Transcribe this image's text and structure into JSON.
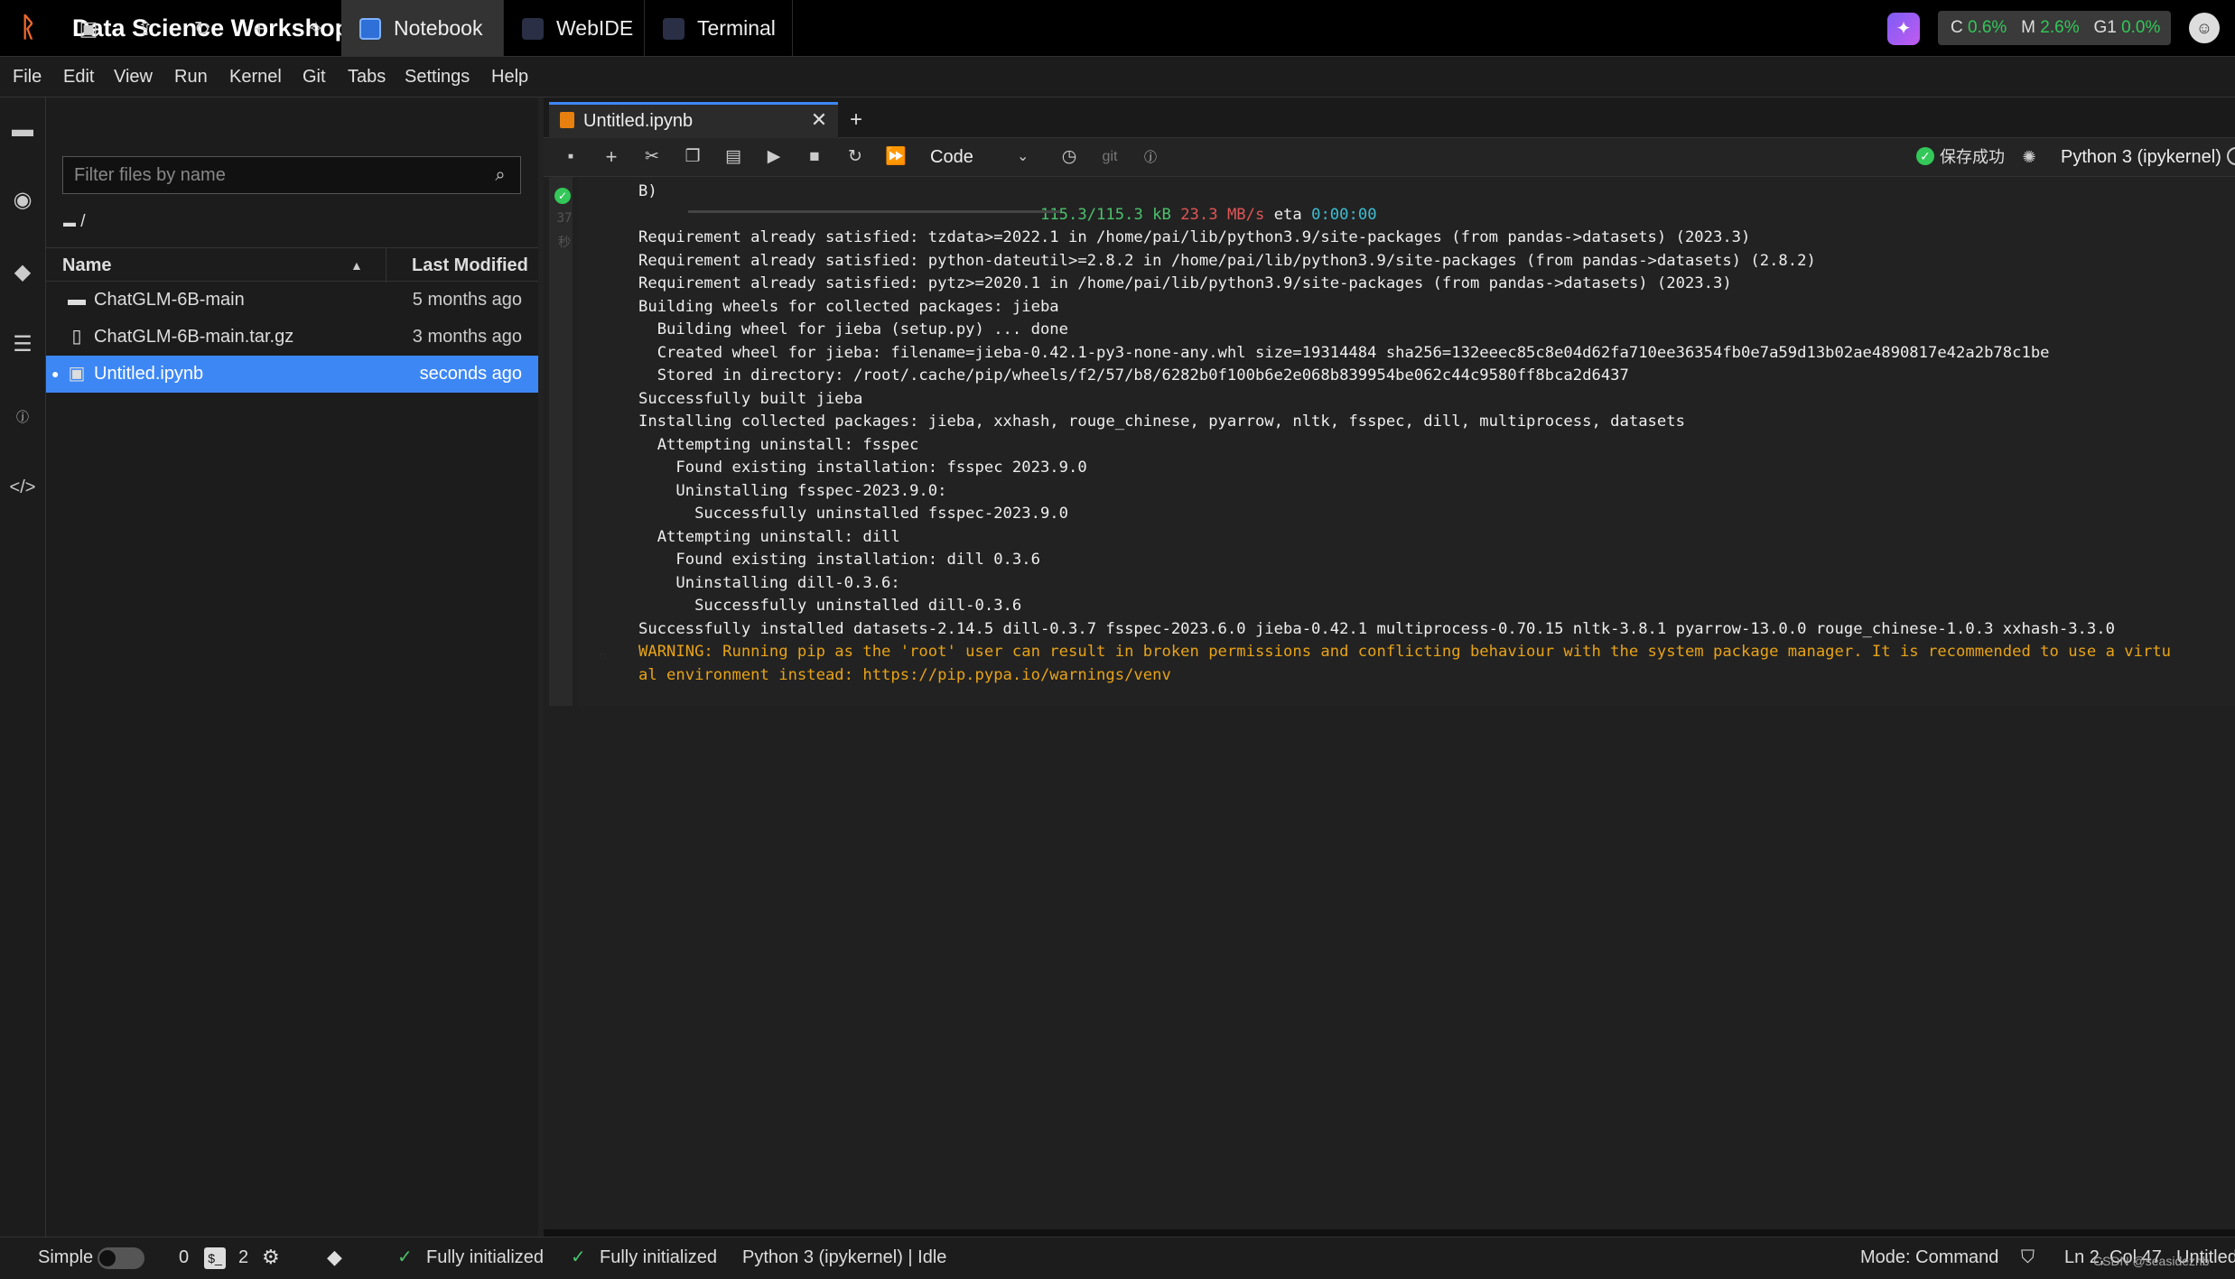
{
  "topbar": {
    "app_title": "Data Science Workshop",
    "tabs": [
      {
        "label": "Notebook",
        "icon": "notebook-icon",
        "active": true
      },
      {
        "label": "WebIDE",
        "icon": "webide-icon"
      },
      {
        "label": "Terminal",
        "icon": "terminal-icon"
      }
    ],
    "resources": {
      "c_label": "C",
      "c_value": "0.6%",
      "m_label": "M",
      "m_value": "2.6%",
      "g_label": "G1",
      "g_value": "0.0%"
    }
  },
  "menu": [
    "File",
    "Edit",
    "View",
    "Run",
    "Kernel",
    "Git",
    "Tabs",
    "Settings",
    "Help"
  ],
  "file_browser": {
    "filter_placeholder": "Filter files by name",
    "breadcrumb": "/",
    "col_name": "Name",
    "col_modified": "Last Modified",
    "files": [
      {
        "name": "ChatGLM-6B-main",
        "modified": "5 months ago",
        "type": "folder"
      },
      {
        "name": "ChatGLM-6B-main.tar.gz",
        "modified": "3 months ago",
        "type": "file"
      },
      {
        "name": "Untitled.ipynb",
        "modified": "seconds ago",
        "type": "notebook",
        "selected": true
      }
    ]
  },
  "notebook": {
    "tab_label": "Untitled.ipynb",
    "cell_type": "Code",
    "save_status": "保存成功",
    "kernel": "Python 3 (ipykernel)",
    "git_label": "git",
    "cell_numbers": [
      "37",
      "秒"
    ]
  },
  "output": {
    "line0": "B)",
    "progress_size": "115.3/115.3 kB",
    "progress_speed": "23.3 MB/s",
    "progress_eta_label": "eta",
    "progress_eta": "0:00:00",
    "lines": [
      "Requirement already satisfied: tzdata>=2022.1 in /home/pai/lib/python3.9/site-packages (from pandas->datasets) (2023.3)",
      "Requirement already satisfied: python-dateutil>=2.8.2 in /home/pai/lib/python3.9/site-packages (from pandas->datasets) (2.8.2)",
      "Requirement already satisfied: pytz>=2020.1 in /home/pai/lib/python3.9/site-packages (from pandas->datasets) (2023.3)",
      "Building wheels for collected packages: jieba",
      "  Building wheel for jieba (setup.py) ... done",
      "  Created wheel for jieba: filename=jieba-0.42.1-py3-none-any.whl size=19314484 sha256=132eeec85c8e04d62fa710ee36354fb0e7a59d13b02ae4890817e42a2b78c1be",
      "  Stored in directory: /root/.cache/pip/wheels/f2/57/b8/6282b0f100b6e2e068b839954be062c44c9580ff8bca2d6437",
      "Successfully built jieba",
      "Installing collected packages: jieba, xxhash, rouge_chinese, pyarrow, nltk, fsspec, dill, multiprocess, datasets",
      "  Attempting uninstall: fsspec",
      "    Found existing installation: fsspec 2023.9.0",
      "    Uninstalling fsspec-2023.9.0:",
      "      Successfully uninstalled fsspec-2023.9.0",
      "  Attempting uninstall: dill",
      "    Found existing installation: dill 0.3.6",
      "    Uninstalling dill-0.3.6:",
      "      Successfully uninstalled dill-0.3.6",
      "Successfully installed datasets-2.14.5 dill-0.3.7 fsspec-2023.6.0 jieba-0.42.1 multiprocess-0.70.15 nltk-3.8.1 pyarrow-13.0.0 rouge_chinese-1.0.3 xxhash-3.3.0"
    ],
    "warning_1": "WARNING: Running pip as the 'root' user can result in broken permissions and conflicting behaviour with the system package manager. It is recommended to use a virtu",
    "warning_2": "al environment instead: https://pip.pypa.io/warnings/venv"
  },
  "statusbar": {
    "mode_label": "Simple",
    "terminals_count": "0",
    "kernels_count": "2",
    "init_1": "Fully initialized",
    "init_2": "Fully initialized",
    "kernel_status": "Python 3 (ipykernel) | Idle",
    "mode": "Mode: Command",
    "position": "Ln 2, Col 47",
    "file": "Untitled.ipynb",
    "watermark": "CSDN @seasidezhb"
  },
  "colors": {
    "accent": "#3d87f5",
    "success": "#34c759",
    "warning": "#e8a317",
    "brand": "#f26b2a"
  }
}
